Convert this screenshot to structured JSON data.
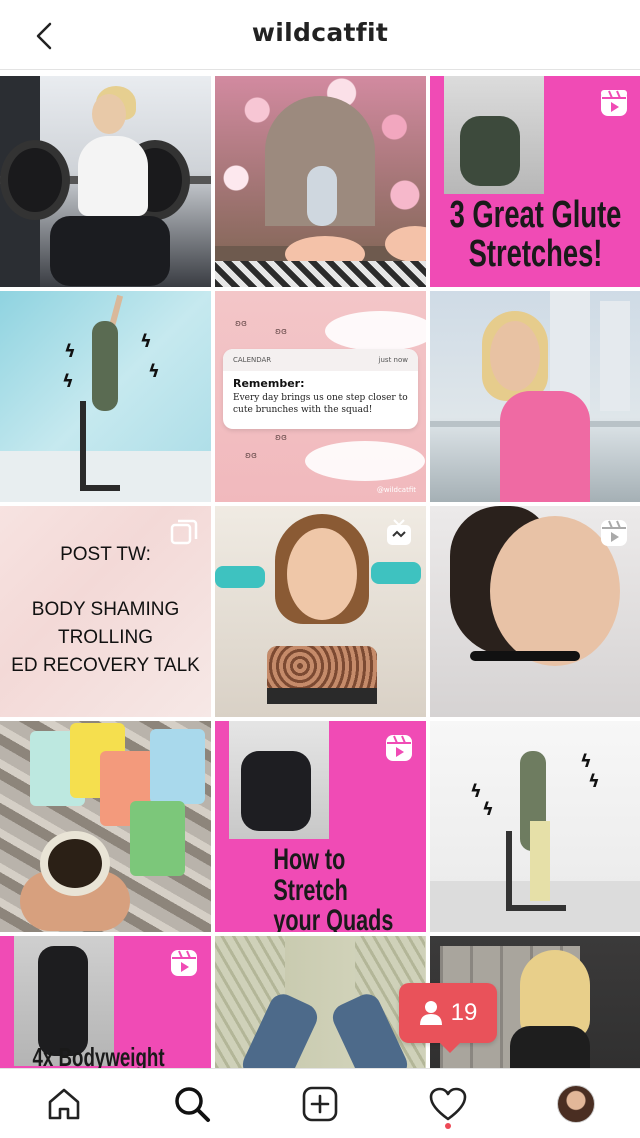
{
  "header": {
    "title": "wildcatfit",
    "back_icon": "chevron-left-icon"
  },
  "posts": [
    {
      "id": "post-1",
      "badge": null
    },
    {
      "id": "post-2",
      "badge": null
    },
    {
      "id": "post-3",
      "badge": "reels-icon",
      "lines": [
        "3 Great Glute",
        "Stretches!"
      ]
    },
    {
      "id": "post-4",
      "badge": null
    },
    {
      "id": "post-5",
      "badge": null,
      "card": {
        "app": "CALENDAR",
        "time": "just now",
        "title": "Remember:",
        "body": "Every day brings us one step closer to cute brunches with the squad!"
      },
      "handle": "@wildcatfit"
    },
    {
      "id": "post-6",
      "badge": null
    },
    {
      "id": "post-7",
      "badge": "carousel-icon",
      "lines": [
        "POST TW:",
        "BODY SHAMING",
        "TROLLING",
        "ED RECOVERY TALK"
      ]
    },
    {
      "id": "post-8",
      "badge": "igtv-icon"
    },
    {
      "id": "post-9",
      "badge": "reels-icon"
    },
    {
      "id": "post-10",
      "badge": null
    },
    {
      "id": "post-11",
      "badge": "reels-icon",
      "lines": [
        "How to Stretch",
        "your Quads"
      ]
    },
    {
      "id": "post-12",
      "badge": null
    },
    {
      "id": "post-13",
      "badge": "reels-icon",
      "lines": [
        "4x Bodyweight"
      ]
    },
    {
      "id": "post-14",
      "badge": null
    },
    {
      "id": "post-15",
      "badge": null
    }
  ],
  "follow_badge": {
    "icon": "person-icon",
    "count": "19"
  },
  "bottom_nav": [
    {
      "icon": "home-icon"
    },
    {
      "icon": "search-icon",
      "active": true
    },
    {
      "icon": "add-post-icon"
    },
    {
      "icon": "heart-icon",
      "has_notification": true
    },
    {
      "icon": "profile-avatar"
    }
  ],
  "colors": {
    "accent_pink": "#f04bb5",
    "notification_red": "#e9525a"
  }
}
